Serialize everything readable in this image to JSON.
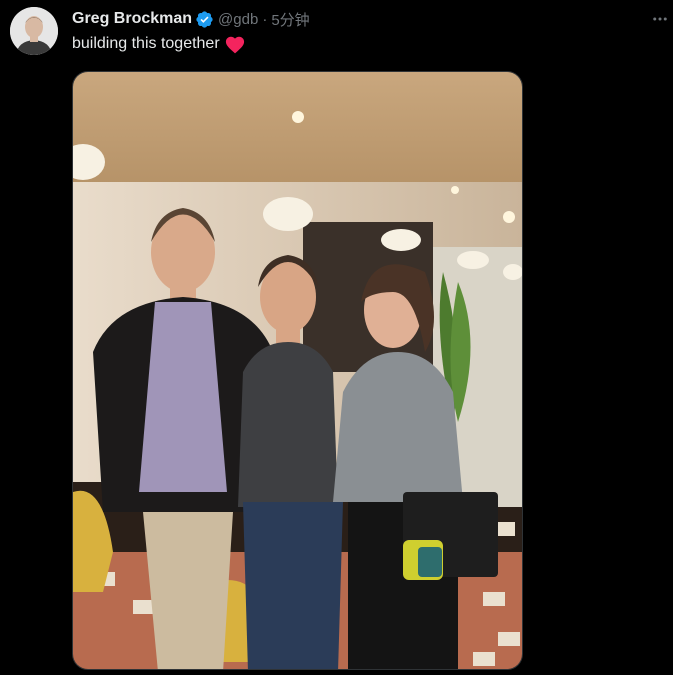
{
  "tweet": {
    "author": {
      "display_name": "Greg Brockman",
      "handle": "@gdb",
      "verified": true,
      "avatar_icon": "profile-avatar"
    },
    "separator": "·",
    "timestamp": "5分钟",
    "text": "building this together",
    "emoji": "red-heart",
    "more_icon": "more-options-icon",
    "media": {
      "type": "photo",
      "alt": "Photo of three people standing together in a restaurant"
    }
  },
  "colors": {
    "background": "#000000",
    "primary_text": "#e7e9ea",
    "secondary_text": "#71767b",
    "verified_blue": "#1d9bf0",
    "heart_red": "#f91880"
  }
}
